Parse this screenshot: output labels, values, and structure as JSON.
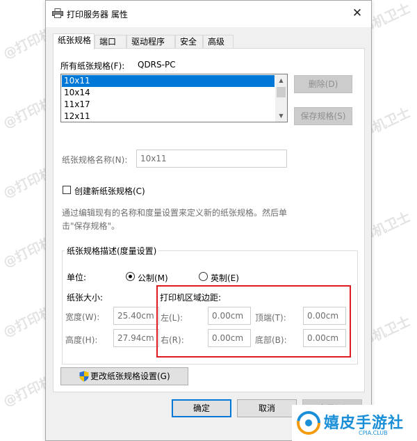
{
  "window": {
    "title": "打印服务器 属性",
    "close_glyph": "✕"
  },
  "tabs": [
    "纸张规格",
    "端口",
    "驱动程序",
    "安全",
    "高级"
  ],
  "forms_section": {
    "label": "所有纸张规格(F):",
    "server": "QDRS-PC",
    "items": [
      "10x11",
      "10x14",
      "11x17",
      "12x11"
    ],
    "selected_index": 0
  },
  "buttons": {
    "delete": "删除(D)",
    "save_form": "保存规格(S)",
    "change_settings": "更改纸张规格设置(G)",
    "ok": "确定",
    "cancel": "取消",
    "apply": "应用(A)"
  },
  "form_name": {
    "label": "纸张规格名称(N):",
    "value": "10x11"
  },
  "create_new": {
    "label": "创建新纸张规格(C)",
    "checked": false
  },
  "help_text": {
    "line1": "通过编辑现有的名称和度量设置来定义新的纸张规格。然后单",
    "line2": "击\"保存规格\"。"
  },
  "description": {
    "group_label": "纸张规格描述(度量设置)",
    "units_label": "单位:",
    "metric": "公制(M)",
    "english": "英制(E)",
    "metric_selected": true,
    "paper_size_label": "纸张大小:",
    "width_label": "宽度(W):",
    "width_value": "25.40cm",
    "height_label": "高度(H):",
    "height_value": "27.94cm",
    "margins_label": "打印机区域边距:",
    "left_label": "左(L):",
    "left_value": "0.00cm",
    "right_label": "右(R):",
    "right_value": "0.00cm",
    "top_label": "顶端(T):",
    "top_value": "0.00cm",
    "bottom_label": "底部(B):",
    "bottom_value": "0.00cm"
  },
  "watermark": {
    "text": "@打印机卫士",
    "brand": "嬉皮手游社",
    "brand_sub": "CPIA.CLUB"
  },
  "colors": {
    "accent": "#0078d7",
    "highlight_box": "#e0191e",
    "brand_orange": "#f39c12",
    "brand_blue": "#1a8fd8"
  }
}
